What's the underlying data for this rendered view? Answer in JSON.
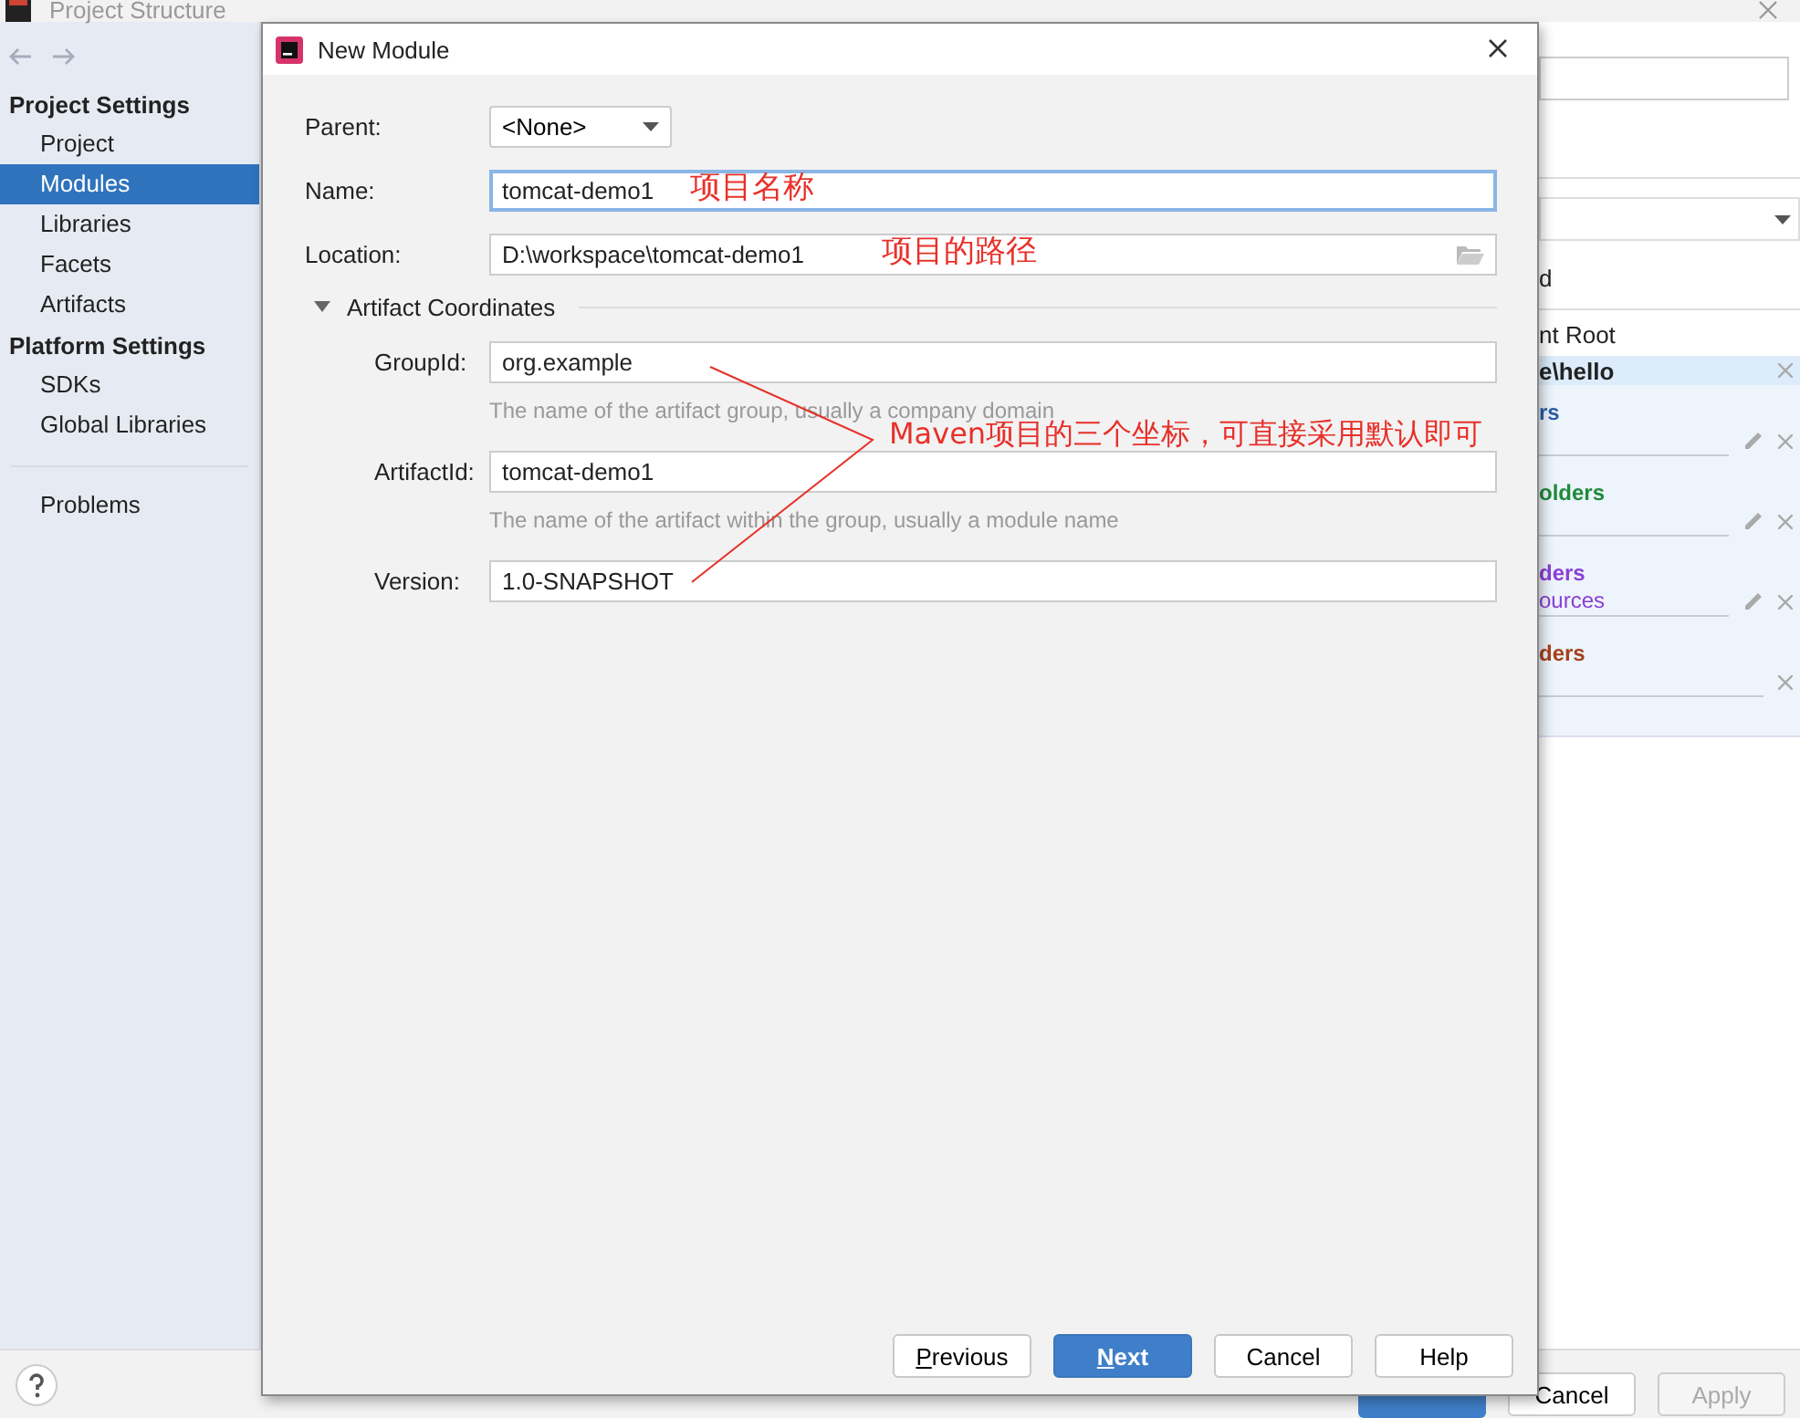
{
  "window": {
    "title": "Project Structure"
  },
  "sidebar": {
    "groups": [
      {
        "heading": "Project Settings",
        "items": [
          {
            "label": "Project",
            "selected": false
          },
          {
            "label": "Modules",
            "selected": true
          },
          {
            "label": "Libraries",
            "selected": false
          },
          {
            "label": "Facets",
            "selected": false
          },
          {
            "label": "Artifacts",
            "selected": false
          }
        ]
      },
      {
        "heading": "Platform Settings",
        "items": [
          {
            "label": "SDKs",
            "selected": false
          },
          {
            "label": "Global Libraries",
            "selected": false
          }
        ]
      }
    ],
    "extra_items": [
      {
        "label": "Problems",
        "selected": false
      }
    ]
  },
  "background_panel": {
    "header_label": "d",
    "root_label": "nt Root",
    "root_path": "e\\hello",
    "folders": [
      {
        "title": "rs",
        "color": "#2b5ea8",
        "editable": true
      },
      {
        "title": "olders",
        "color": "#1f8a3b",
        "editable": true
      },
      {
        "title": "ders",
        "color": "#8a3fd6",
        "path": "ources",
        "editable": true
      },
      {
        "title": "ders",
        "color": "#a5401a",
        "editable": false
      }
    ]
  },
  "background_buttons": [
    {
      "label": "Cancel",
      "disabled": false
    },
    {
      "label": "Apply",
      "disabled": true
    }
  ],
  "dialog": {
    "title": "New Module",
    "parent": {
      "label": "Parent:",
      "value": "<None>"
    },
    "fields": [
      {
        "label": "Name:",
        "value": "tomcat-demo1",
        "focused": true,
        "kind": "text"
      },
      {
        "label": "Location:",
        "value": "D:\\workspace\\tomcat-demo1",
        "focused": false,
        "kind": "path"
      }
    ],
    "section": {
      "title": "Artifact Coordinates",
      "expanded": true,
      "fields": [
        {
          "label": "GroupId:",
          "value": "org.example",
          "hint": "The name of the artifact group, usually a company domain"
        },
        {
          "label": "ArtifactId:",
          "value": "tomcat-demo1",
          "hint": "The name of the artifact within the group, usually a module name"
        },
        {
          "label": "Version:",
          "value": "1.0-SNAPSHOT"
        }
      ]
    },
    "buttons": [
      {
        "label": "Previous",
        "primary": false,
        "underline_first": true
      },
      {
        "label": "Next",
        "primary": true,
        "underline_first": true
      },
      {
        "label": "Cancel",
        "primary": false,
        "underline_first": false
      },
      {
        "label": "Help",
        "primary": false,
        "underline_first": false
      }
    ]
  },
  "annotations": [
    {
      "text": "项目名称"
    },
    {
      "text": "项目的路径"
    },
    {
      "text": "Maven项目的三个坐标，可直接采用默认即可"
    }
  ]
}
